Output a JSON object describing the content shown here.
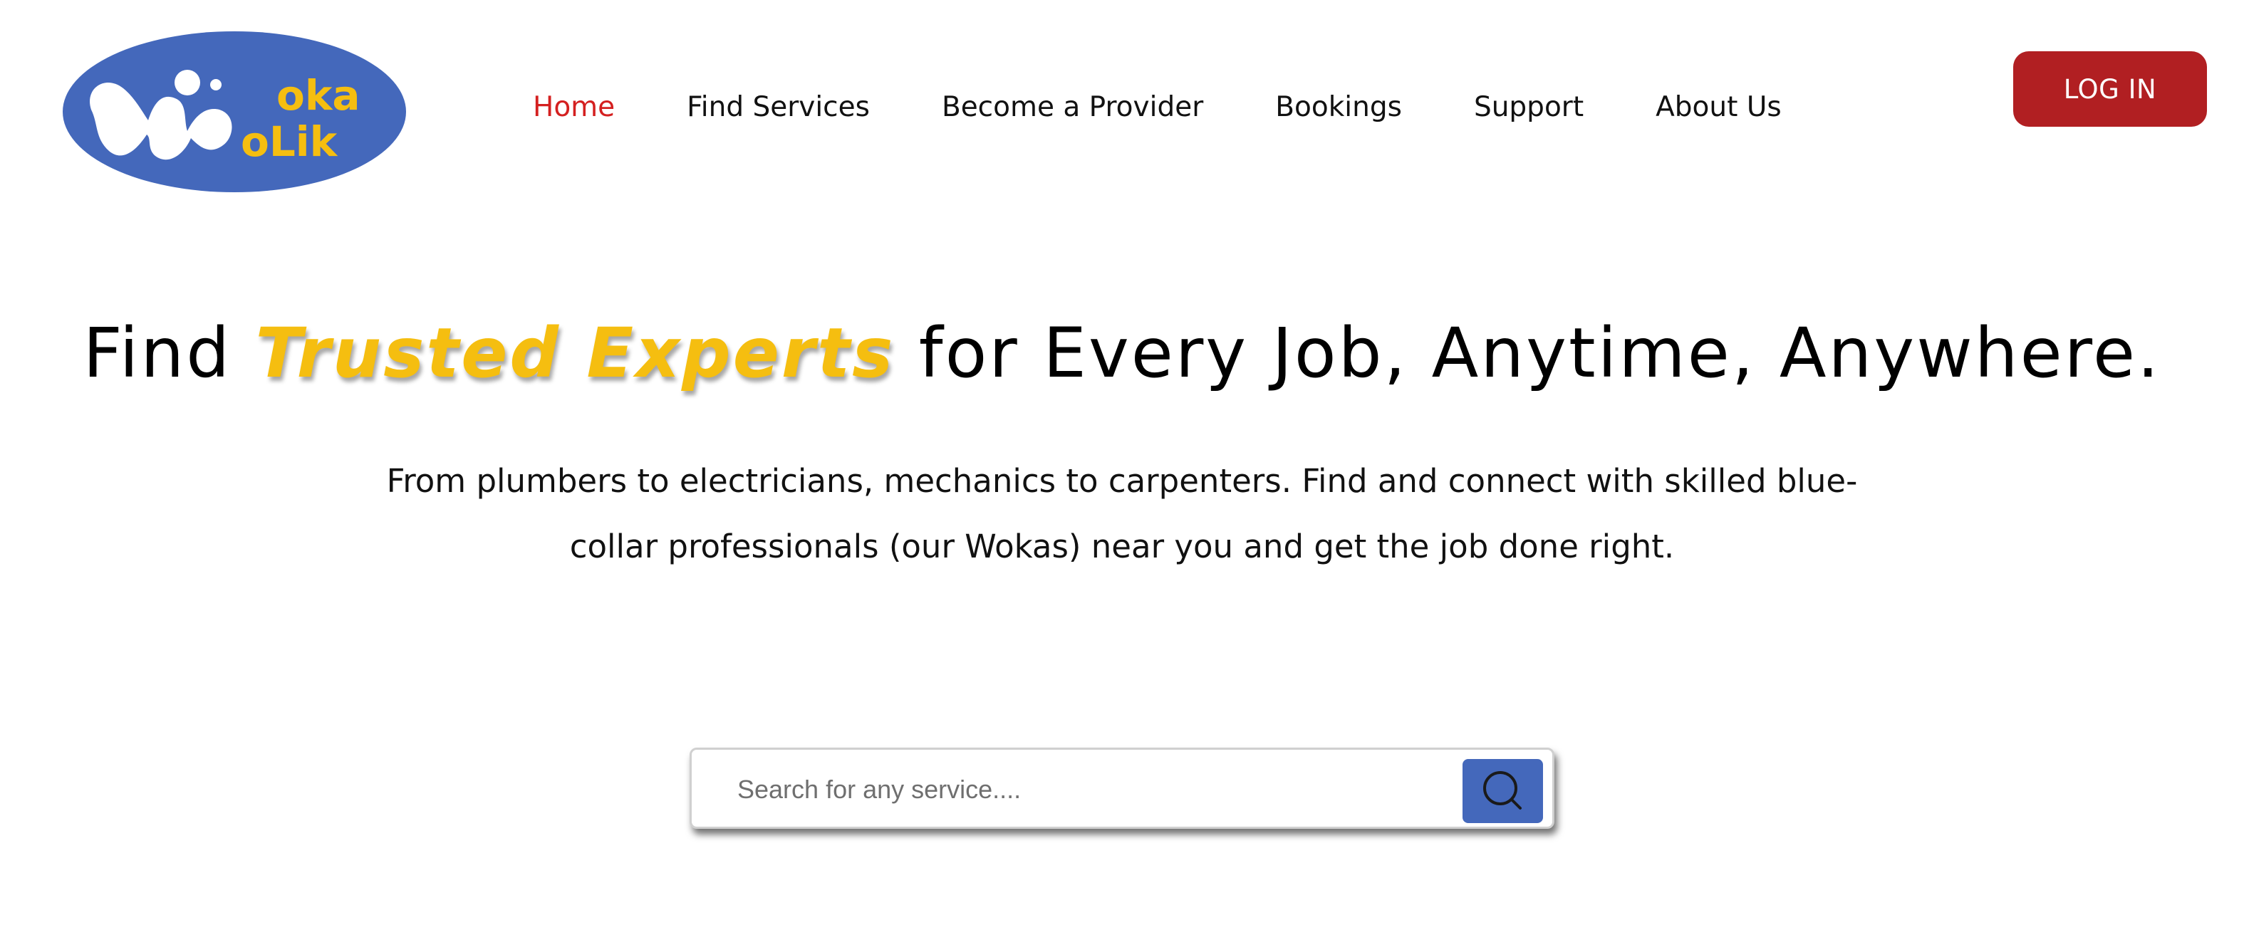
{
  "colors": {
    "brand_blue": "#4468BB",
    "brand_yellow": "#F5BE10",
    "accent_red": "#D42020",
    "button_red": "#B11F22",
    "text_dark": "#111111"
  },
  "header": {
    "logo": {
      "text": "WokaLik",
      "icon": "wokalik-logo"
    },
    "nav": [
      {
        "label": "Home",
        "active": true
      },
      {
        "label": "Find Services",
        "active": false
      },
      {
        "label": "Become a Provider",
        "active": false
      },
      {
        "label": "Bookings",
        "active": false
      },
      {
        "label": "Support",
        "active": false
      },
      {
        "label": "About Us",
        "active": false
      }
    ],
    "login_label": "LOG IN"
  },
  "hero": {
    "title_prefix": "Find ",
    "title_highlight": "Trusted Experts",
    "title_suffix": " for Every Job, Anytime, Anywhere.",
    "subtitle": "From plumbers to electricians, mechanics to carpenters. Find and connect with skilled blue-collar professionals (our Wokas) near you and get the job done right."
  },
  "search": {
    "placeholder": "Search for any service....",
    "value": "",
    "button_icon": "search-icon"
  }
}
